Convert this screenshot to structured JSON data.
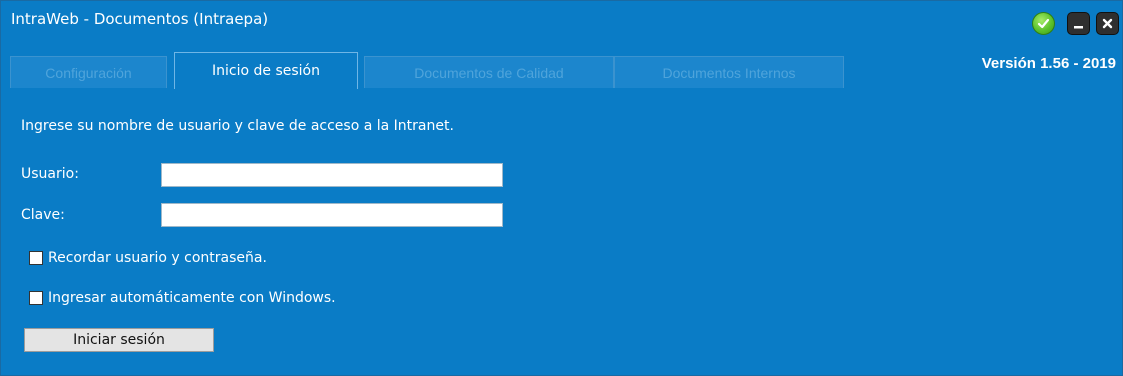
{
  "window": {
    "title": "IntraWeb - Documentos (Intraepa)",
    "version": "Versión 1.56 - 2019"
  },
  "tabs": [
    {
      "label": "Configuración",
      "active": false
    },
    {
      "label": "Inicio de sesión",
      "active": true
    },
    {
      "label": "Documentos de Calidad",
      "active": false
    },
    {
      "label": "Documentos Internos",
      "active": false
    }
  ],
  "login": {
    "intro": "Ingrese su nombre de usuario y clave de acceso a la Intranet.",
    "user_label": "Usuario:",
    "user_value": "",
    "password_label": "Clave:",
    "password_value": "",
    "remember_label": "Recordar usuario y contraseña.",
    "remember_checked": false,
    "auto_login_label": "Ingresar automáticamente con Windows.",
    "auto_login_checked": false,
    "submit_label": "Iniciar sesión"
  },
  "icons": {
    "confirm": "check-icon",
    "minimize": "minimize-icon",
    "close": "close-icon"
  },
  "colors": {
    "window_background": "#0a7cc6",
    "text": "#ffffff",
    "inactive_tab_text": "#4fa4db",
    "confirm_button": "#5cc22c",
    "window_buttons": "#2f2f2f"
  }
}
